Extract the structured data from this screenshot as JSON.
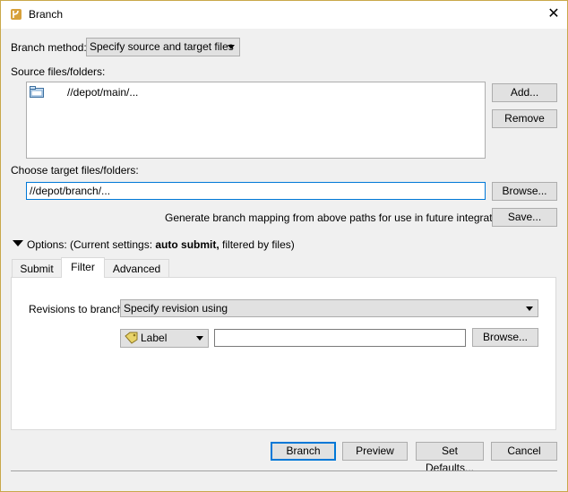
{
  "window": {
    "title": "Branch"
  },
  "branch_method": {
    "label": "Branch method:",
    "value": "Specify source and target files"
  },
  "source": {
    "label": "Source files/folders:",
    "items": [
      "//depot/main/..."
    ],
    "add_label": "Add...",
    "remove_label": "Remove"
  },
  "target": {
    "label": "Choose target files/folders:",
    "value": "//depot/branch/...",
    "browse_label": "Browse..."
  },
  "mapping": {
    "text": "Generate branch mapping from above paths for use in future integrations:",
    "save_label": "Save..."
  },
  "options": {
    "label": "Options:",
    "settings_prefix": "(Current settings: ",
    "settings_bold": "auto submit,",
    "settings_suffix": " filtered by files)"
  },
  "tabs": [
    "Submit",
    "Filter",
    "Advanced"
  ],
  "active_tab": "Filter",
  "filter": {
    "revisions_label": "Revisions to branch:",
    "revisions_value": "Specify revision using",
    "type_value": "Label",
    "value": "",
    "browse_label": "Browse..."
  },
  "footer": {
    "branch_label": "Branch",
    "preview_label": "Preview",
    "set_defaults_label": "Set Defaults...",
    "cancel_label": "Cancel"
  }
}
